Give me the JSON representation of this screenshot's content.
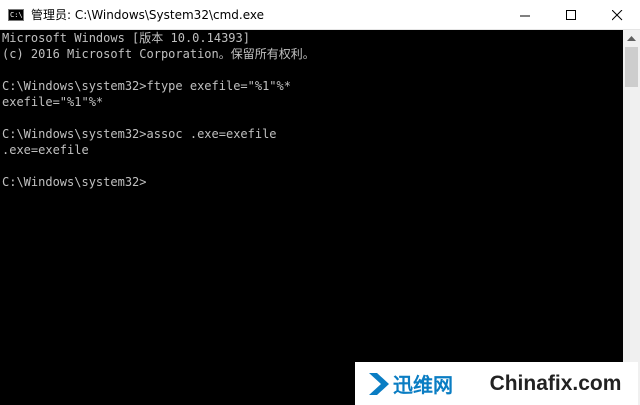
{
  "window": {
    "title": "管理员: C:\\Windows\\System32\\cmd.exe",
    "icon_text": "C:\\"
  },
  "controls": {
    "minimize_icon": "minimize-icon",
    "maximize_icon": "maximize-icon",
    "close_icon": "close-icon"
  },
  "console": {
    "lines": [
      "Microsoft Windows [版本 10.0.14393]",
      "(c) 2016 Microsoft Corporation。保留所有权利。",
      "",
      "C:\\Windows\\system32>ftype exefile=\"%1\"%*",
      "exefile=\"%1\"%*",
      "",
      "C:\\Windows\\system32>assoc .exe=exefile",
      ".exe=exefile",
      "",
      "C:\\Windows\\system32>"
    ],
    "text_color": "#c0c0c0",
    "background": "#000000"
  },
  "watermark": {
    "cn_text": "迅维网",
    "site_text": "Chinafix.com",
    "accent": "#0a7dc3"
  }
}
